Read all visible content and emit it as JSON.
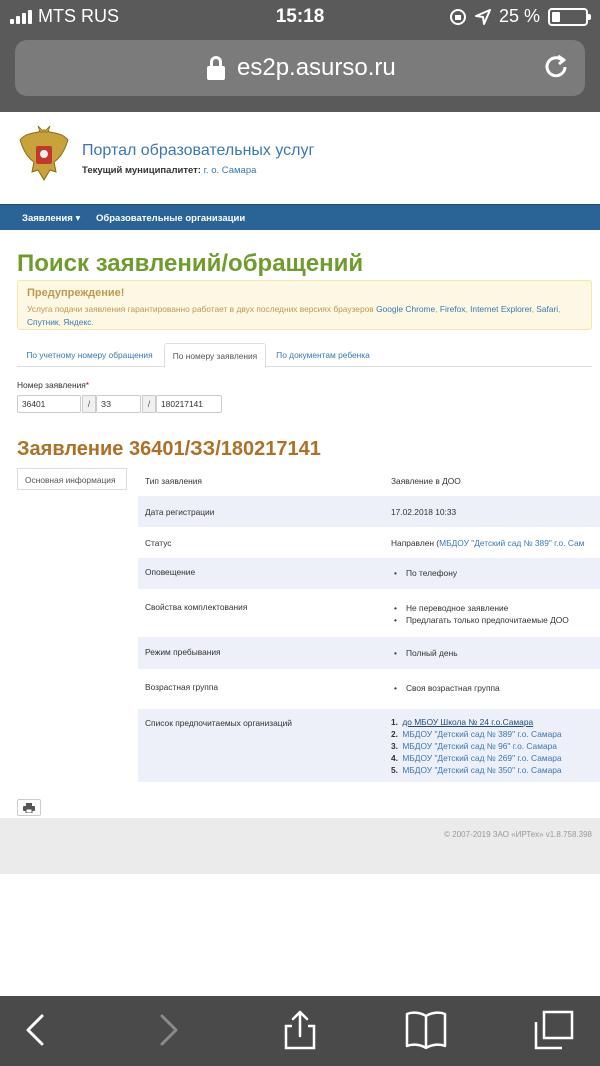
{
  "status_bar": {
    "carrier": "MTS RUS",
    "time": "15:18",
    "battery": "25 %",
    "battery_level": 0.25
  },
  "browser": {
    "url": "es2p.asurso.ru"
  },
  "header": {
    "portal_title": "Портал образовательных услуг",
    "municipality_label": "Текущий муниципалитет:",
    "municipality_value": "г. о. Самара"
  },
  "nav": {
    "items": [
      {
        "label": "Заявления ▾"
      },
      {
        "label": "Образовательные организации"
      }
    ]
  },
  "page": {
    "title": "Поиск заявлений/обращений"
  },
  "warning": {
    "title": "Предупреждение!",
    "text_prefix": "Услуга подачи заявления гарантированно работает в двух последних версиях браузеров",
    "browsers": [
      "Google Chrome",
      "Firefox",
      "Internet Explorer",
      "Safari",
      "Спутник",
      "Яндекс"
    ]
  },
  "tabs": [
    {
      "label": "По учетному номеру обращения",
      "active": false
    },
    {
      "label": "По номеру заявления",
      "active": true
    },
    {
      "label": "По документам ребенка",
      "active": false
    }
  ],
  "form": {
    "label": "Номер заявления",
    "required_mark": "*",
    "part1": "36401",
    "part2": "ЗЗ",
    "part3": "180217141",
    "separator": "/"
  },
  "application": {
    "title": "Заявление 36401/ЗЗ/180217141",
    "side_tab": "Основная информация",
    "rows": {
      "type": {
        "key": "Тип заявления",
        "value": "Заявление в ДОО"
      },
      "reg_date": {
        "key": "Дата регистрации",
        "value": "17.02.2018 10:33"
      },
      "status": {
        "key": "Статус",
        "value_prefix": "Направлен (",
        "value_link": "МБДОУ \"Детский сад № 389\" г.о. Сам"
      },
      "notification": {
        "key": "Оповещение",
        "items": [
          "По телефону"
        ]
      },
      "staffing": {
        "key": "Свойства комплектования",
        "items": [
          "Не переводное заявление",
          "Предлагать только предпочитаемые ДОО"
        ]
      },
      "stay_mode": {
        "key": "Режим пребывания",
        "items": [
          "Полный день"
        ]
      },
      "age_group": {
        "key": "Возрастная группа",
        "items": [
          "Своя возрастная группа"
        ]
      },
      "preferred": {
        "key": "Список предпочитаемых организаций",
        "items": [
          {
            "n": "1.",
            "name": "до МБОУ Школа № 24 г.о.Самара"
          },
          {
            "n": "2.",
            "name": "МБДОУ \"Детский сад № 389\" г.о. Самара"
          },
          {
            "n": "3.",
            "name": "МБДОУ \"Детский сад № 96\" г.о. Самара"
          },
          {
            "n": "4.",
            "name": "МБДОУ \"Детский сад № 269\" г.о. Самара"
          },
          {
            "n": "5.",
            "name": "МБДОУ \"Детский сад № 350\" г.о. Самара"
          }
        ]
      }
    }
  },
  "footer": {
    "copyright": "© 2007-2019 ЗАО «ИРТех» v1.8.758.398"
  },
  "icons": {
    "emblem": "russian-coat-of-arms-icon",
    "print": "printer-icon",
    "back": "chevron-left-icon",
    "forward": "chevron-right-icon",
    "share": "share-icon",
    "bookmarks": "book-icon",
    "tabs": "tabs-icon",
    "reload": "reload-icon",
    "lock": "lock-icon"
  },
  "colors": {
    "title_green": "#6e9d2d",
    "app_title_orange": "#b06f26",
    "nav_blue": "#2a6496",
    "link_blue": "#3a78b0"
  }
}
